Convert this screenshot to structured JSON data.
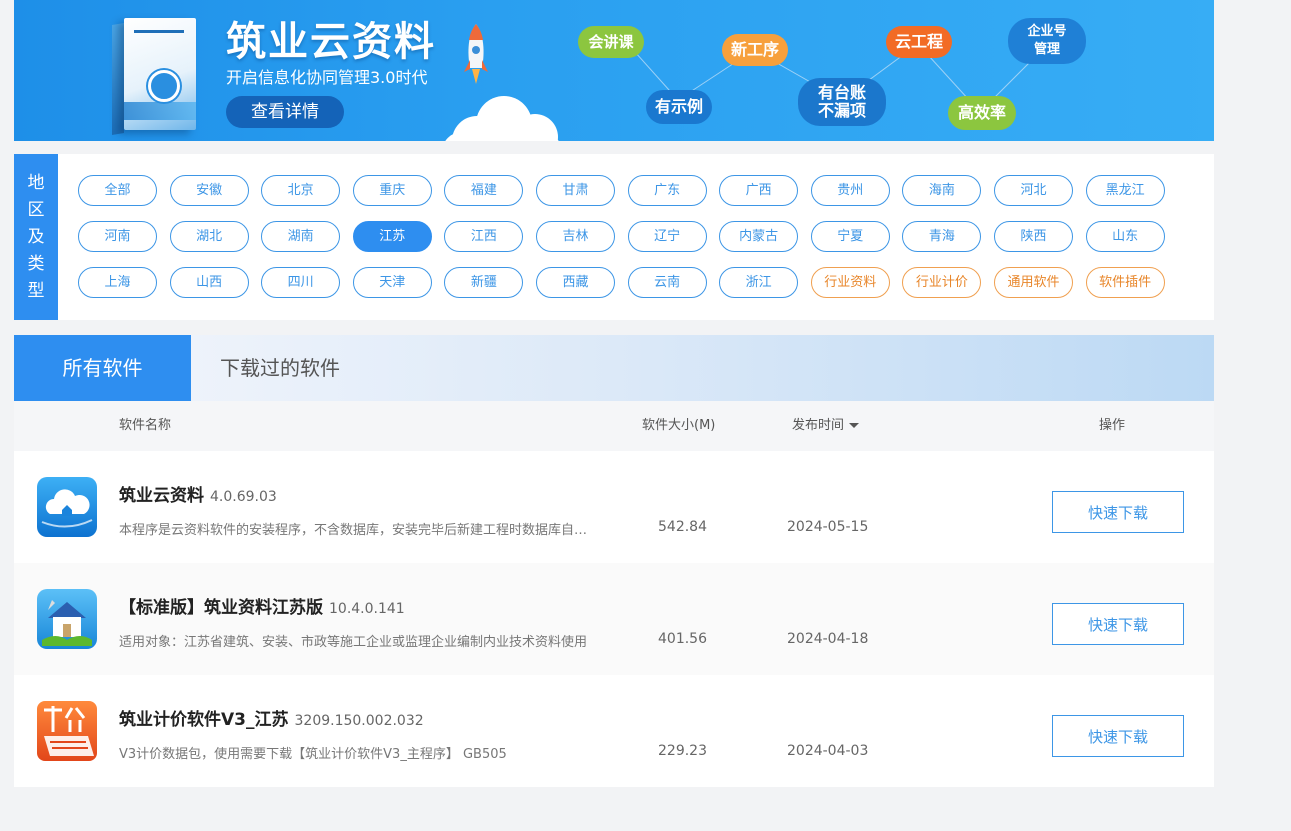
{
  "banner": {
    "title": "筑业云资料",
    "subtitle": "开启信息化协同管理3.0时代",
    "button_label": "查看详情",
    "tags": [
      "会讲课",
      "新工序",
      "云工程",
      "企业号管理",
      "有示例",
      "有台账不漏项",
      "高效率"
    ]
  },
  "filter": {
    "label_chars": [
      "地",
      "区",
      "及",
      "类",
      "型"
    ],
    "regions": [
      "全部",
      "安徽",
      "北京",
      "重庆",
      "福建",
      "甘肃",
      "广东",
      "广西",
      "贵州",
      "海南",
      "河北",
      "黑龙江",
      "河南",
      "湖北",
      "湖南",
      "江苏",
      "江西",
      "吉林",
      "辽宁",
      "内蒙古",
      "宁夏",
      "青海",
      "陕西",
      "山东",
      "上海",
      "山西",
      "四川",
      "天津",
      "新疆",
      "西藏",
      "云南",
      "浙江"
    ],
    "types": [
      "行业资料",
      "行业计价",
      "通用软件",
      "软件插件"
    ],
    "selected": "江苏"
  },
  "tabs": {
    "all": "所有软件",
    "downloaded": "下载过的软件"
  },
  "table": {
    "headers": {
      "name": "软件名称",
      "size": "软件大小(M)",
      "date": "发布时间",
      "action": "操作"
    },
    "rows": [
      {
        "name": "筑业云资料",
        "version": "4.0.69.03",
        "desc": "本程序是云资料软件的安装程序，不含数据库，安装完毕后新建工程时数据库自动下载",
        "size": "542.84",
        "date": "2024-05-15",
        "button": "快速下载",
        "icon": "cloud-house-icon"
      },
      {
        "name": "【标准版】筑业资料江苏版",
        "version": "10.4.0.141",
        "desc": "适用对象：江苏省建筑、安装、市政等施工企业或监理企业编制内业技术资料使用",
        "size": "401.56",
        "date": "2024-04-18",
        "button": "快速下载",
        "icon": "house-icon"
      },
      {
        "name": "筑业计价软件V3_江苏",
        "version": "3209.150.002.032",
        "desc": "V3计价数据包，使用需要下载【筑业计价软件V3_主程序】 GB505",
        "size": "229.23",
        "date": "2024-04-03",
        "button": "快速下载",
        "icon": "pricing-icon"
      }
    ]
  },
  "colors": {
    "accent": "#2e8ef0",
    "orange": "#e8862a"
  }
}
